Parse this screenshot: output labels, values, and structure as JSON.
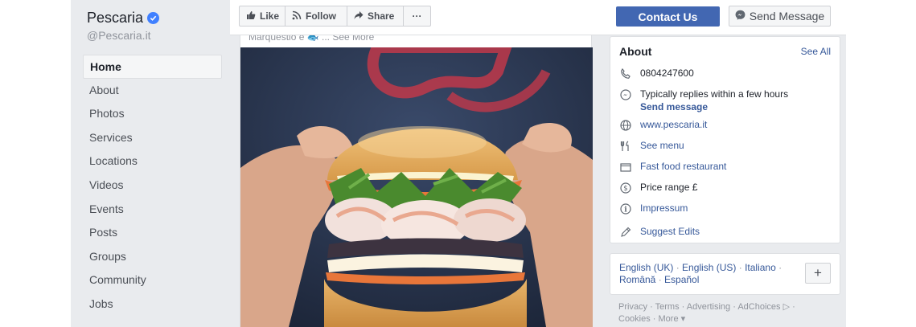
{
  "page": {
    "name": "Pescaria",
    "handle": "@Pescaria.it"
  },
  "sidebar": {
    "items": [
      {
        "label": "Home",
        "active": true
      },
      {
        "label": "About"
      },
      {
        "label": "Photos"
      },
      {
        "label": "Services"
      },
      {
        "label": "Locations"
      },
      {
        "label": "Videos"
      },
      {
        "label": "Events"
      },
      {
        "label": "Posts"
      },
      {
        "label": "Groups"
      },
      {
        "label": "Community"
      },
      {
        "label": "Jobs"
      }
    ]
  },
  "toolbar": {
    "like_label": "Like",
    "follow_label": "Follow",
    "share_label": "Share",
    "more_label": "···",
    "contact_label": "Contact Us",
    "message_label": "Send Message"
  },
  "post": {
    "caption": "Marquestio è 🐟 ... See More"
  },
  "about": {
    "title": "About",
    "see_all": "See All",
    "phone": "0804247600",
    "replies": "Typically replies within a few hours",
    "send_message": "Send message",
    "website": "www.pescaria.it",
    "menu": "See menu",
    "category": "Fast food restaurant",
    "price_range": "Price range £",
    "impressum": "Impressum",
    "suggest_edits": "Suggest Edits"
  },
  "languages": {
    "items": [
      "English (UK)",
      "English (US)",
      "Italiano",
      "Română",
      "Español"
    ],
    "add_label": "+"
  },
  "footer": {
    "line1": "Privacy · Terms · Advertising · AdChoices ▷ ·",
    "line2": "Cookies · More ▾"
  },
  "colors": {
    "brand_blue": "#4267b2",
    "link_blue": "#365899",
    "background": "#e9ebee"
  }
}
